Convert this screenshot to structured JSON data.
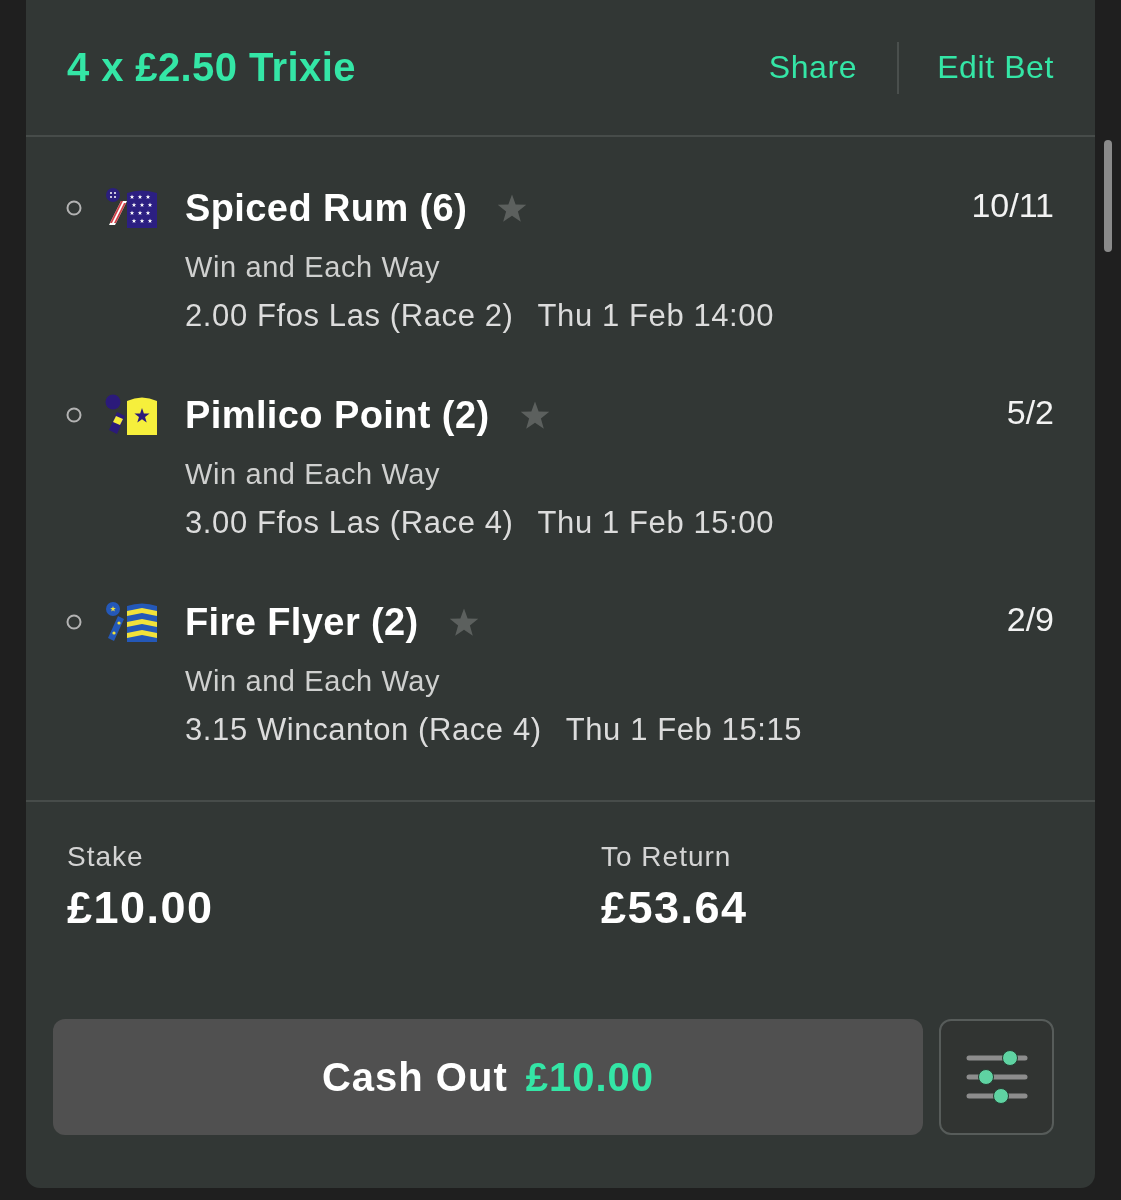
{
  "bet": {
    "title": "4 x £2.50 Trixie",
    "actions": [
      "Share",
      "Edit Bet"
    ]
  },
  "selections": [
    {
      "kind": "stars",
      "name": "Spiced Rum (6)",
      "favourite": false,
      "odds": "10/11",
      "market": "Win and Each Way",
      "race": "2.00 Ffos Las (Race 2)",
      "time": "Thu 1 Feb 14:00"
    },
    {
      "kind": "star",
      "name": "Pimlico Point (2)",
      "favourite": false,
      "odds": "5/2",
      "market": "Win and Each Way",
      "race": "3.00 Ffos Las (Race 4)",
      "time": "Thu 1 Feb 15:00"
    },
    {
      "kind": "bands",
      "name": "Fire Flyer (2)",
      "favourite": false,
      "odds": "2/9",
      "market": "Win and Each Way",
      "race": "3.15 Wincanton (Race 4)",
      "time": "Thu 1 Feb 15:15"
    }
  ],
  "summary": [
    {
      "label": "Stake",
      "value": "£10.00"
    },
    {
      "label": "To Return",
      "value": "£53.64"
    }
  ],
  "cash_out": {
    "label": "Cash Out",
    "amount": "£10.00"
  }
}
